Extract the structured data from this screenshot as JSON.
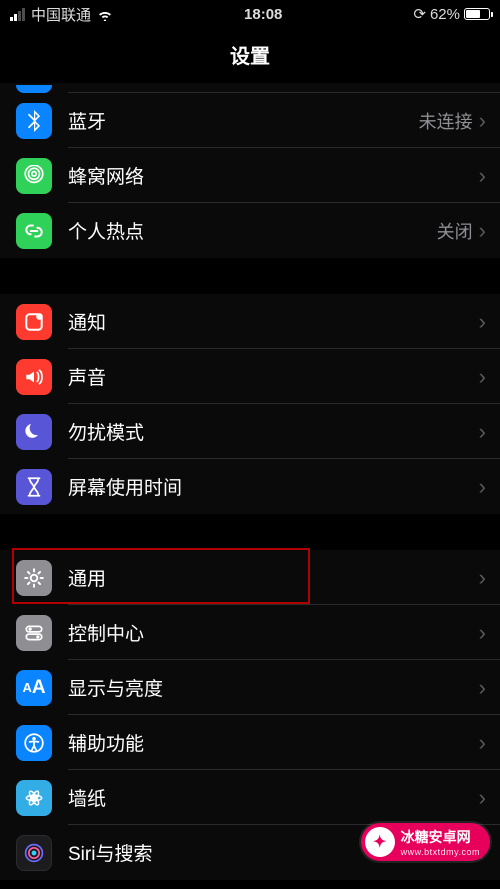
{
  "status": {
    "carrier": "中国联通",
    "time": "18:08",
    "battery_pct": "62%"
  },
  "header": {
    "title": "设置"
  },
  "rows": {
    "bluetooth": {
      "label": "蓝牙",
      "value": "未连接"
    },
    "cellular": {
      "label": "蜂窝网络"
    },
    "hotspot": {
      "label": "个人热点",
      "value": "关闭"
    },
    "notifications": {
      "label": "通知"
    },
    "sounds": {
      "label": "声音"
    },
    "dnd": {
      "label": "勿扰模式"
    },
    "screentime": {
      "label": "屏幕使用时间"
    },
    "general": {
      "label": "通用"
    },
    "controlcenter": {
      "label": "控制中心"
    },
    "display": {
      "label": "显示与亮度"
    },
    "accessibility": {
      "label": "辅助功能"
    },
    "wallpaper": {
      "label": "墙纸"
    },
    "siri": {
      "label": "Siri与搜索"
    }
  },
  "watermark": {
    "brand": "冰糖安卓网",
    "url": "www.btxtdmy.com"
  },
  "highlight_target": "general"
}
